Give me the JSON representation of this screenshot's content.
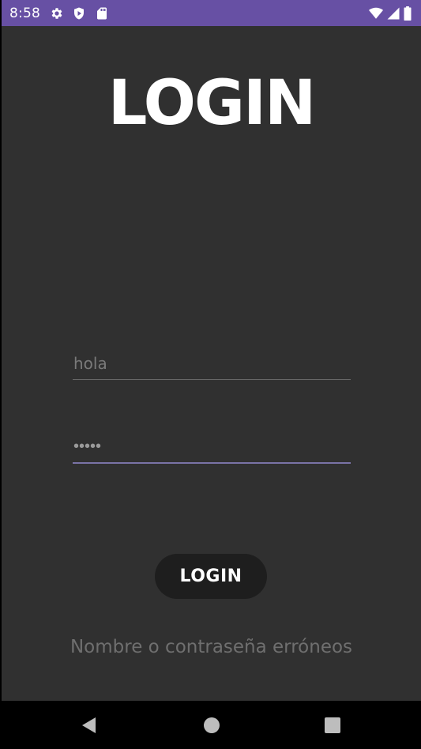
{
  "status_bar": {
    "time": "8:58",
    "left_icons": [
      "gear-icon",
      "play-protect-icon",
      "sd-card-icon"
    ],
    "right_icons": [
      "wifi-icon",
      "cell-signal-icon",
      "battery-icon"
    ],
    "color": "#6750a4"
  },
  "screen": {
    "title": "LOGIN",
    "background": "#303030"
  },
  "form": {
    "username": {
      "value": "",
      "placeholder": "hola"
    },
    "password": {
      "masked_value": "•••••"
    },
    "login_button_label": "LOGIN",
    "error_message": "Nombre o contraseña erróneos"
  },
  "nav_bar": {
    "buttons": [
      "back-icon",
      "home-icon",
      "recents-icon"
    ]
  }
}
